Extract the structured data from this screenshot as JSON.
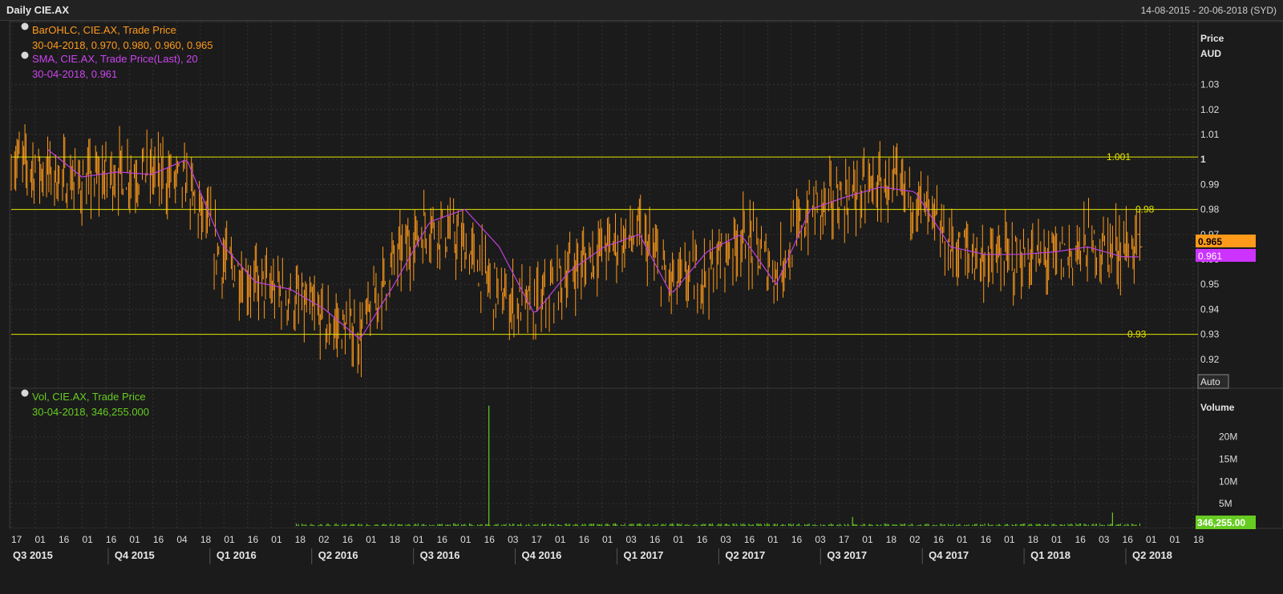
{
  "window": {
    "title": "Daily CIE.AX",
    "date_range": "14-08-2015 - 20-06-2018 (SYD)"
  },
  "legend": {
    "price_series": "BarOHLC, CIE.AX, Trade Price",
    "price_values": "30-04-2018, 0.970, 0.980, 0.960, 0.965",
    "sma_series": "SMA, CIE.AX, Trade Price(Last),  20",
    "sma_values": "30-04-2018, 0.961",
    "vol_series": "Vol, CIE.AX, Trade Price",
    "vol_values": "30-04-2018, 346,255.000"
  },
  "axis": {
    "price_title_1": "Price",
    "price_title_2": "AUD",
    "volume_title": "Volume",
    "auto_label": "Auto"
  },
  "badges": {
    "last_price": "0.965",
    "last_sma": "0.961",
    "last_volume": "346,255.00"
  },
  "colors": {
    "background": "#1b1b1b",
    "price_bars": "#ff9a1a",
    "sma": "#c040e0",
    "volume": "#66cc22",
    "hlines": "#e6e600",
    "grid": "#333333",
    "text": "#dddddd"
  },
  "chart_data": [
    {
      "type": "ohlc",
      "title": "Daily CIE.AX",
      "ylabel": "Price AUD",
      "ylim": [
        0.91,
        1.035
      ],
      "y_ticks": [
        "1.03",
        "1.02",
        "1.01",
        "1",
        "0.99",
        "0.98",
        "0.97",
        "0.96",
        "0.95",
        "0.94",
        "0.93",
        "0.92"
      ],
      "x_range": [
        "14-08-2015",
        "20-06-2018"
      ],
      "x_tick_labels": [
        "17",
        "01",
        "16",
        "01",
        "16",
        "01",
        "16",
        "04",
        "18",
        "01",
        "16",
        "01",
        "18",
        "02",
        "16",
        "01",
        "18",
        "01",
        "16",
        "01",
        "16",
        "03",
        "17",
        "01",
        "16",
        "01",
        "03",
        "16",
        "01",
        "16",
        "03",
        "16",
        "01",
        "16",
        "03",
        "17",
        "01",
        "18",
        "02",
        "16",
        "01",
        "16",
        "01",
        "18",
        "01",
        "16",
        "03",
        "16",
        "01",
        "01",
        "18"
      ],
      "x_quarter_labels": [
        "Q3 2015",
        "Q4 2015",
        "Q1 2016",
        "Q2 2016",
        "Q3 2016",
        "Q4 2016",
        "Q1 2017",
        "Q2 2017",
        "Q3 2017",
        "Q4 2017",
        "Q1 2018",
        "Q2 2018"
      ],
      "horizontal_lines": [
        {
          "value": 1.001,
          "label": "1.001"
        },
        {
          "value": 0.98,
          "label": "0.98"
        },
        {
          "value": 0.93,
          "label": "0.93"
        }
      ],
      "series": [
        {
          "name": "BarOHLC, CIE.AX, Trade Price",
          "last": {
            "date": "30-04-2018",
            "open": 0.97,
            "high": 0.98,
            "low": 0.96,
            "close": 0.965
          },
          "approx_close_path": [
            [
              "2015-08",
              1.0
            ],
            [
              "2015-09",
              0.995
            ],
            [
              "2015-10",
              0.99
            ],
            [
              "2015-11",
              0.995
            ],
            [
              "2015-12",
              0.995
            ],
            [
              "2016-01",
              0.99
            ],
            [
              "2016-02",
              0.96
            ],
            [
              "2016-03",
              0.95
            ],
            [
              "2016-04",
              0.945
            ],
            [
              "2016-05",
              0.935
            ],
            [
              "2016-06",
              0.93
            ],
            [
              "2016-07",
              0.96
            ],
            [
              "2016-08",
              0.975
            ],
            [
              "2016-09",
              0.965
            ],
            [
              "2016-10",
              0.945
            ],
            [
              "2016-11",
              0.94
            ],
            [
              "2016-12",
              0.955
            ],
            [
              "2017-01",
              0.965
            ],
            [
              "2017-02",
              0.97
            ],
            [
              "2017-03",
              0.95
            ],
            [
              "2017-04",
              0.955
            ],
            [
              "2017-05",
              0.97
            ],
            [
              "2017-06",
              0.955
            ],
            [
              "2017-07",
              0.98
            ],
            [
              "2017-08",
              0.985
            ],
            [
              "2017-09",
              0.99
            ],
            [
              "2017-10",
              0.985
            ],
            [
              "2017-11",
              0.965
            ],
            [
              "2017-12",
              0.96
            ],
            [
              "2018-01",
              0.96
            ],
            [
              "2018-02",
              0.96
            ],
            [
              "2018-03",
              0.965
            ],
            [
              "2018-04",
              0.965
            ]
          ]
        },
        {
          "name": "SMA, CIE.AX, Trade Price(Last),  20",
          "last": {
            "date": "30-04-2018",
            "value": 0.961
          },
          "approx_path": [
            [
              "2015-09",
              1.004
            ],
            [
              "2015-10",
              0.993
            ],
            [
              "2015-11",
              0.995
            ],
            [
              "2015-12",
              0.994
            ],
            [
              "2016-01",
              1.0
            ],
            [
              "2016-02",
              0.966
            ],
            [
              "2016-03",
              0.951
            ],
            [
              "2016-04",
              0.948
            ],
            [
              "2016-05",
              0.94
            ],
            [
              "2016-06",
              0.928
            ],
            [
              "2016-07",
              0.95
            ],
            [
              "2016-08",
              0.975
            ],
            [
              "2016-09",
              0.98
            ],
            [
              "2016-10",
              0.965
            ],
            [
              "2016-11",
              0.938
            ],
            [
              "2016-12",
              0.955
            ],
            [
              "2017-01",
              0.965
            ],
            [
              "2017-02",
              0.97
            ],
            [
              "2017-03",
              0.946
            ],
            [
              "2017-04",
              0.963
            ],
            [
              "2017-05",
              0.97
            ],
            [
              "2017-06",
              0.95
            ],
            [
              "2017-07",
              0.98
            ],
            [
              "2017-08",
              0.985
            ],
            [
              "2017-09",
              0.989
            ],
            [
              "2017-10",
              0.987
            ],
            [
              "2017-11",
              0.965
            ],
            [
              "2017-12",
              0.962
            ],
            [
              "2018-01",
              0.962
            ],
            [
              "2018-02",
              0.963
            ],
            [
              "2018-03",
              0.965
            ],
            [
              "2018-04",
              0.961
            ]
          ]
        }
      ]
    },
    {
      "type": "bar",
      "ylabel": "Volume",
      "ylim": [
        0,
        30000000
      ],
      "y_ticks": [
        "20M",
        "15M",
        "10M",
        "5M"
      ],
      "series": [
        {
          "name": "Vol, CIE.AX, Trade Price",
          "last": {
            "date": "30-04-2018",
            "value": 346255
          },
          "notable": [
            {
              "date": "2016-10-06",
              "value": 27000000
            },
            {
              "date": "2017-08-21",
              "value": 2000000
            },
            {
              "date": "2018-04-06",
              "value": 3000000
            }
          ]
        }
      ]
    }
  ]
}
